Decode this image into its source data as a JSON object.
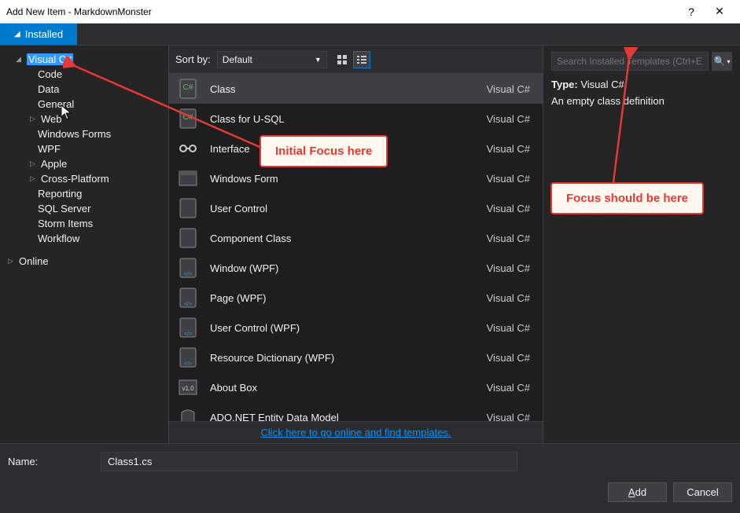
{
  "window": {
    "title": "Add New Item - MarkdownMonster",
    "help": "?",
    "close": "✕"
  },
  "tabs": {
    "installed": "Installed",
    "online": "Online"
  },
  "tree": {
    "root": "Visual C#",
    "items": [
      {
        "label": "Code",
        "expandable": false
      },
      {
        "label": "Data",
        "expandable": false
      },
      {
        "label": "General",
        "expandable": false
      },
      {
        "label": "Web",
        "expandable": true
      },
      {
        "label": "Windows Forms",
        "expandable": false
      },
      {
        "label": "WPF",
        "expandable": false
      },
      {
        "label": "Apple",
        "expandable": true
      },
      {
        "label": "Cross-Platform",
        "expandable": true
      },
      {
        "label": "Reporting",
        "expandable": false
      },
      {
        "label": "SQL Server",
        "expandable": false
      },
      {
        "label": "Storm Items",
        "expandable": false
      },
      {
        "label": "Workflow",
        "expandable": false
      }
    ]
  },
  "toolbar": {
    "sort_label": "Sort by:",
    "sort_value": "Default"
  },
  "templates": [
    {
      "name": "Class",
      "lang": "Visual C#",
      "icon": "class"
    },
    {
      "name": "Class for U-SQL",
      "lang": "Visual C#",
      "icon": "class"
    },
    {
      "name": "Interface",
      "lang": "Visual C#",
      "icon": "interface"
    },
    {
      "name": "Windows Form",
      "lang": "Visual C#",
      "icon": "form"
    },
    {
      "name": "User Control",
      "lang": "Visual C#",
      "icon": "usercontrol"
    },
    {
      "name": "Component Class",
      "lang": "Visual C#",
      "icon": "component"
    },
    {
      "name": "Window (WPF)",
      "lang": "Visual C#",
      "icon": "wpf"
    },
    {
      "name": "Page (WPF)",
      "lang": "Visual C#",
      "icon": "wpf-page"
    },
    {
      "name": "User Control (WPF)",
      "lang": "Visual C#",
      "icon": "wpf-uc"
    },
    {
      "name": "Resource Dictionary (WPF)",
      "lang": "Visual C#",
      "icon": "wpf-rd"
    },
    {
      "name": "About Box",
      "lang": "Visual C#",
      "icon": "about"
    },
    {
      "name": "ADO.NET Entity Data Model",
      "lang": "Visual C#",
      "icon": "ado"
    }
  ],
  "online_link": "Click here to go online and find templates.",
  "search": {
    "placeholder": "Search Installed Templates (Ctrl+E)"
  },
  "detail": {
    "type_label": "Type:",
    "type_value": "Visual C#",
    "description": "An empty class definition"
  },
  "bottom": {
    "name_label": "Name:",
    "name_value": "Class1.cs",
    "add": "Add",
    "cancel": "Cancel"
  },
  "annotations": {
    "initial": "Initial Focus here",
    "should": "Focus should be here"
  }
}
